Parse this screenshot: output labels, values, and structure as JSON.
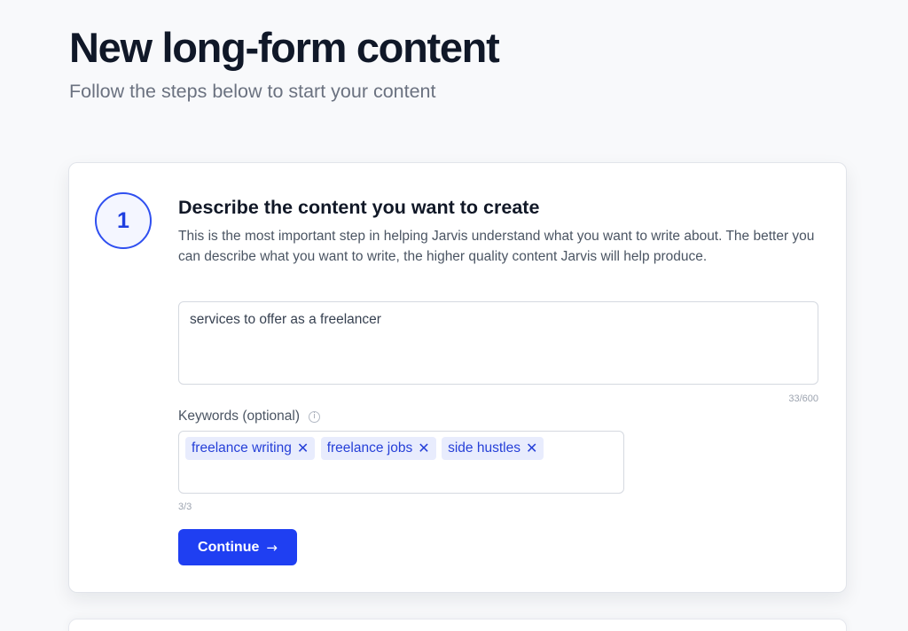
{
  "header": {
    "title": "New long-form content",
    "subtitle": "Follow the steps below to start your content"
  },
  "step": {
    "number": "1",
    "title": "Describe the content you want to create",
    "description": "This is the most important step in helping Jarvis understand what you want to write about. The better you can describe what you want to write, the higher quality content Jarvis will help produce.",
    "content_value": "services to offer as a freelancer",
    "char_count": "33/600",
    "keywords_label": "Keywords (optional)",
    "keywords": [
      {
        "label": "freelance writing",
        "remove_icon": "close-icon"
      },
      {
        "label": "freelance jobs",
        "remove_icon": "close-icon"
      },
      {
        "label": "side hustles",
        "remove_icon": "close-icon"
      }
    ],
    "keywords_count": "3/3",
    "continue_label": "Continue",
    "continue_icon": "arrow-right-icon"
  },
  "colors": {
    "accent": "#1f3ff2",
    "tag_bg": "#e8ecfd",
    "tag_text": "#2640d8"
  }
}
